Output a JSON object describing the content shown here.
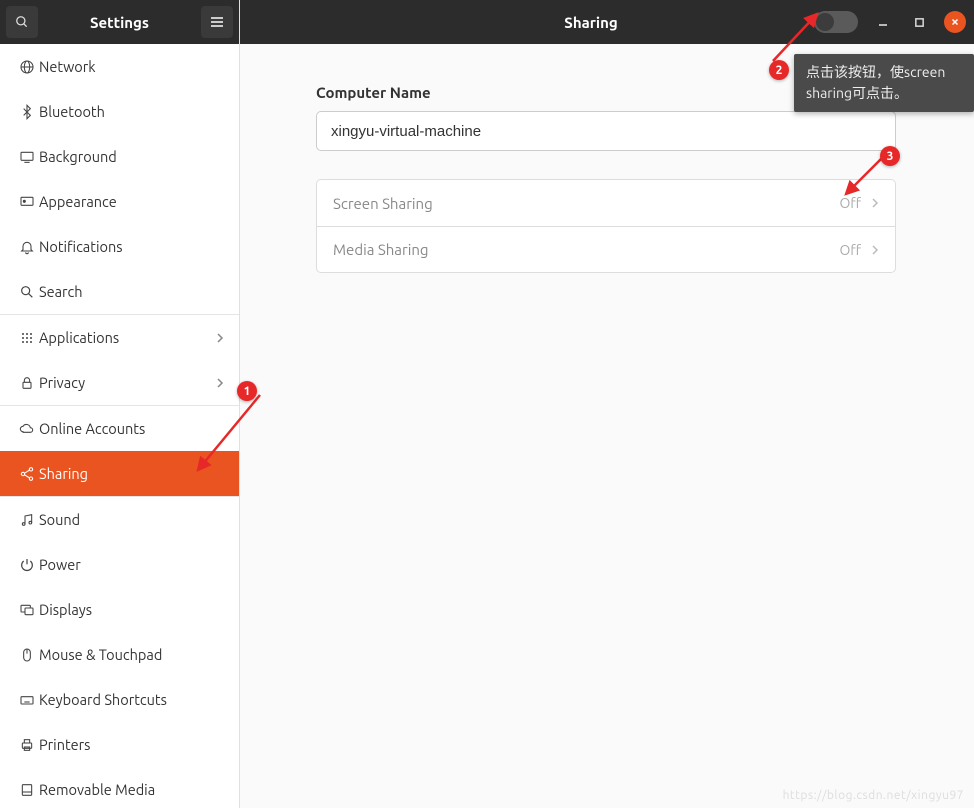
{
  "sidebar": {
    "title": "Settings",
    "items": [
      {
        "label": "Network",
        "icon": "globe-icon"
      },
      {
        "label": "Bluetooth",
        "icon": "bluetooth-icon"
      },
      {
        "label": "Background",
        "icon": "desktop-icon"
      },
      {
        "label": "Appearance",
        "icon": "appearance-icon"
      },
      {
        "label": "Notifications",
        "icon": "bell-icon"
      },
      {
        "label": "Search",
        "icon": "search-icon"
      },
      {
        "label": "Applications",
        "icon": "apps-icon",
        "chevron": true,
        "sep_before": true
      },
      {
        "label": "Privacy",
        "icon": "lock-icon",
        "chevron": true
      },
      {
        "label": "Online Accounts",
        "icon": "cloud-icon",
        "sep_before": true
      },
      {
        "label": "Sharing",
        "icon": "share-icon",
        "selected": true
      },
      {
        "label": "Sound",
        "icon": "music-icon",
        "sep_before": true
      },
      {
        "label": "Power",
        "icon": "power-icon"
      },
      {
        "label": "Displays",
        "icon": "displays-icon"
      },
      {
        "label": "Mouse & Touchpad",
        "icon": "mouse-icon"
      },
      {
        "label": "Keyboard Shortcuts",
        "icon": "keyboard-icon"
      },
      {
        "label": "Printers",
        "icon": "printer-icon"
      },
      {
        "label": "Removable Media",
        "icon": "disk-icon"
      }
    ]
  },
  "main": {
    "title": "Sharing",
    "computer_name_label": "Computer Name",
    "computer_name_value": "xingyu-virtual-machine",
    "rows": [
      {
        "label": "Screen Sharing",
        "status": "Off"
      },
      {
        "label": "Media Sharing",
        "status": "Off"
      }
    ]
  },
  "annotations": {
    "badge1": "1",
    "badge2": "2",
    "badge3": "3",
    "tooltip": "点击该按钮，使screen sharing可点击。"
  },
  "watermark": "https://blog.csdn.net/xingyu97"
}
